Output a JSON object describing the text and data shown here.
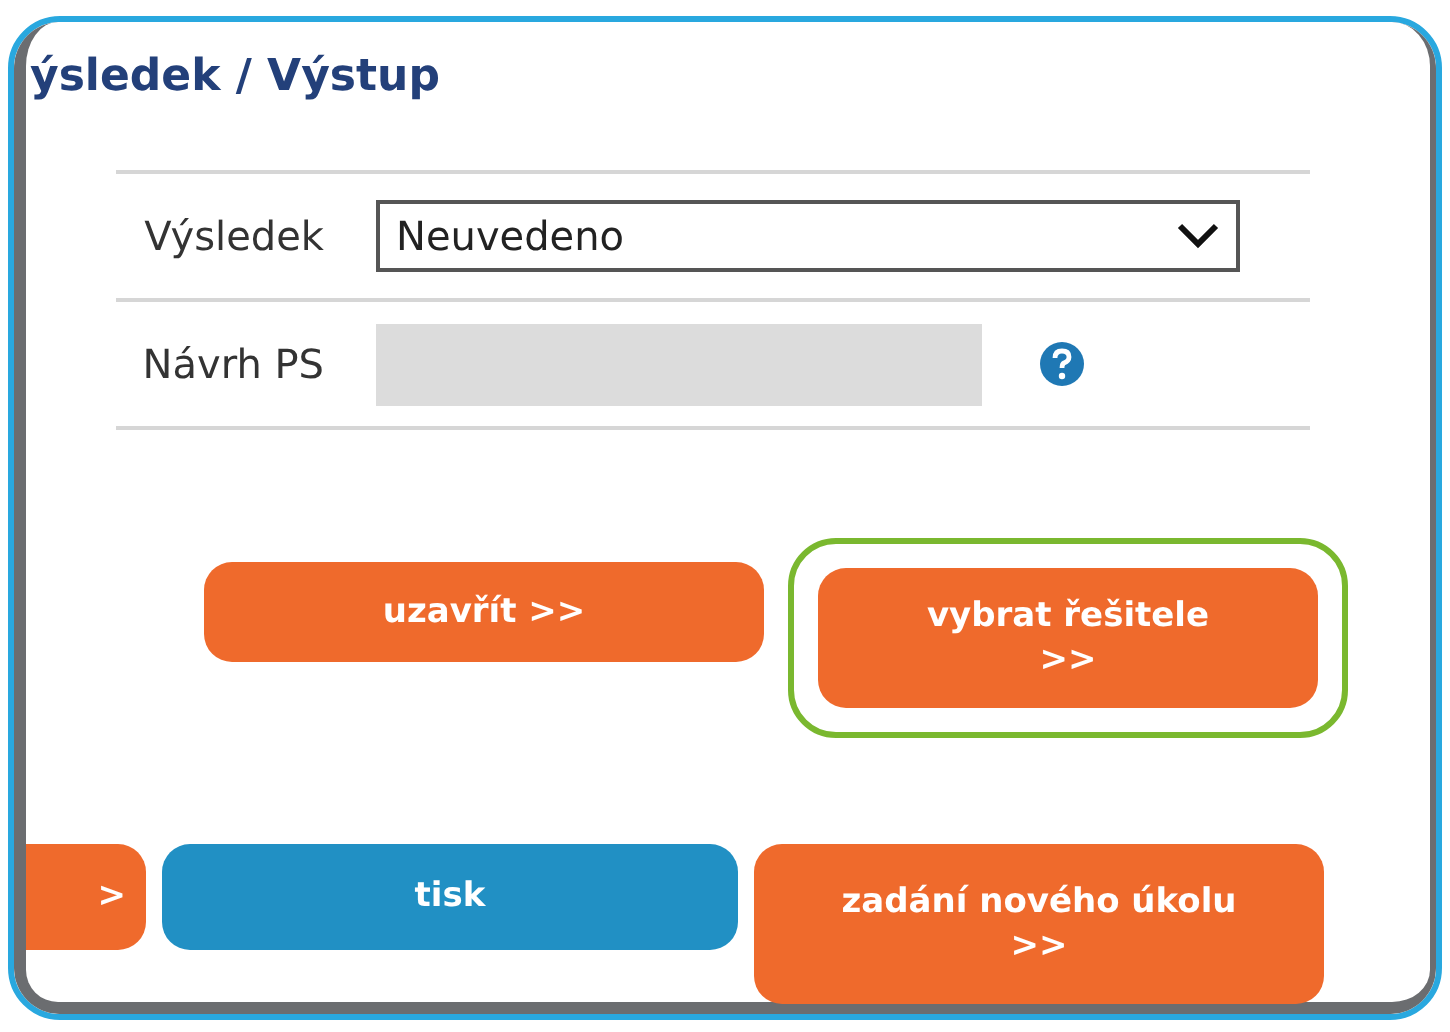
{
  "section": {
    "title": "ýsledek / Výstup"
  },
  "fields": [
    {
      "label": "Výsledek",
      "kind": "select",
      "value": "Neuvedeno"
    },
    {
      "label": "Návrh PS",
      "kind": "readonly",
      "help": true
    }
  ],
  "button_rows": [
    [
      {
        "label": "uzavřít >>",
        "color": "#ef6a2c",
        "highlighted": false
      },
      {
        "label": "vybrat řešitele >>",
        "color": "#ef6a2c",
        "highlighted": true
      }
    ],
    [
      {
        "label": ">",
        "color": "#ef6a2c",
        "highlighted": false
      },
      {
        "label": "tisk",
        "color": "#2190c4",
        "highlighted": false
      },
      {
        "label": "zadání nového úkolu >>",
        "color": "#ef6a2c",
        "highlighted": false
      }
    ]
  ]
}
